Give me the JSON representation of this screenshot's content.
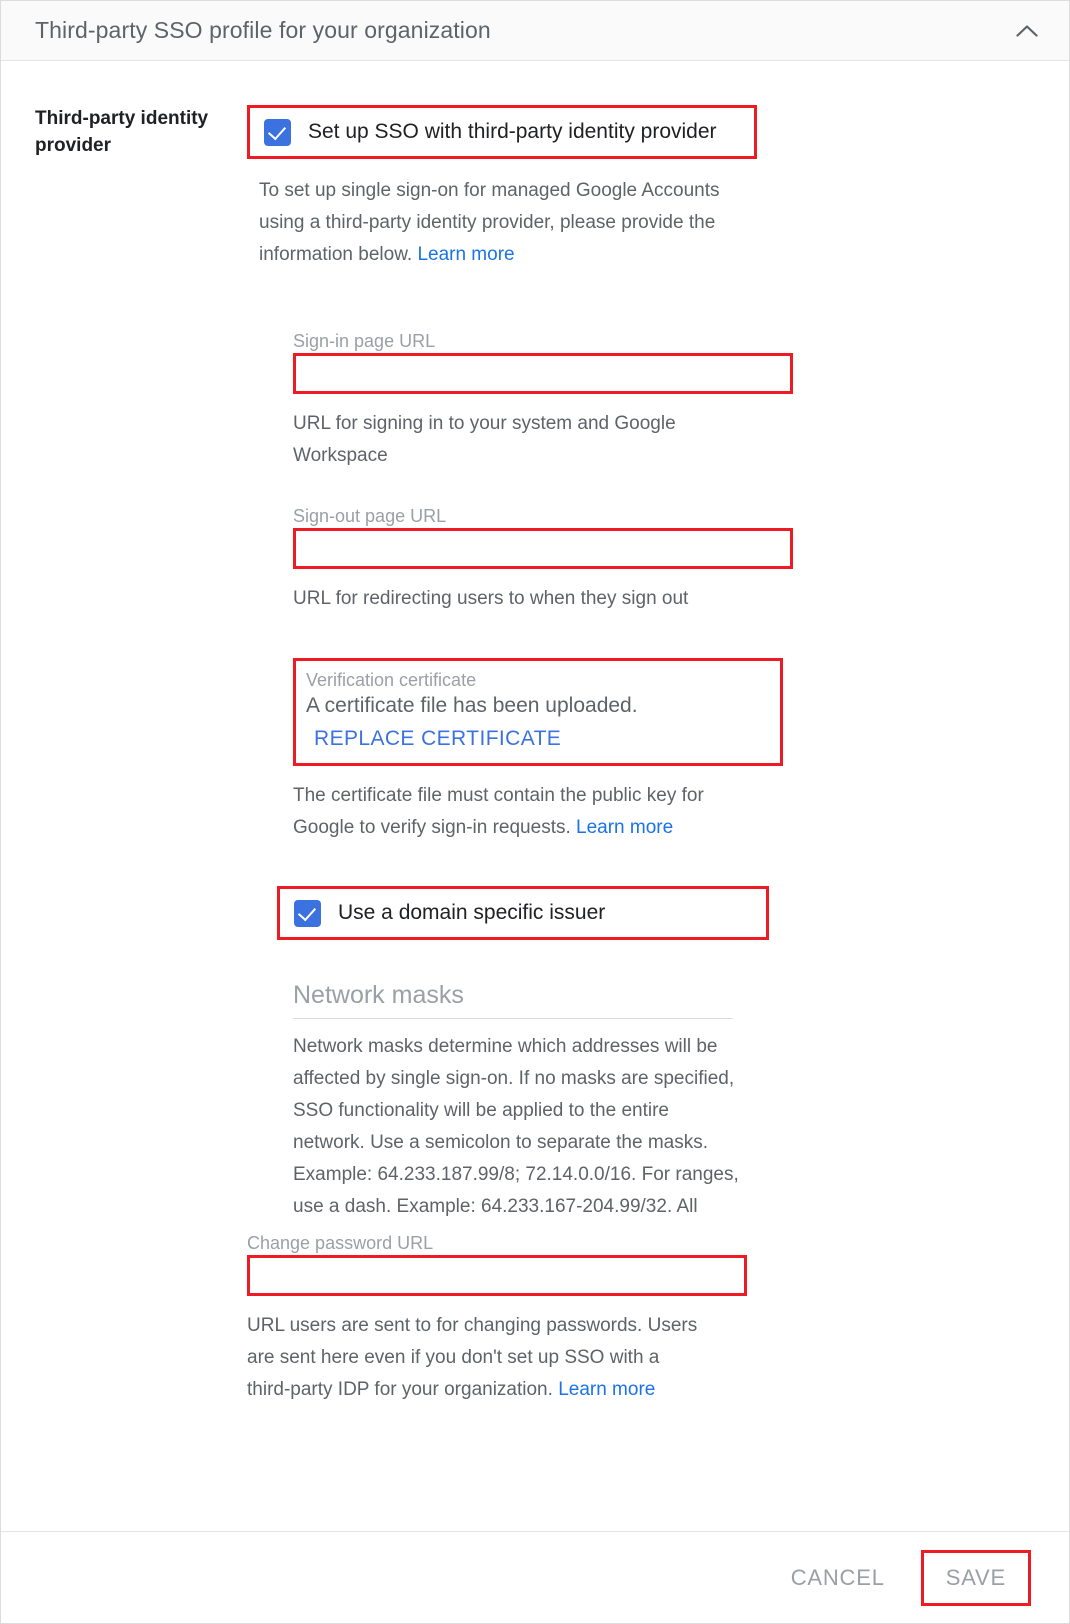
{
  "header": {
    "title": "Third-party SSO profile for your organization",
    "collapse_icon": "chevron-up-icon"
  },
  "section": {
    "left_label": "Third-party identity provider",
    "sso_checkbox": {
      "label": "Set up SSO with third-party identity provider",
      "checked": true
    },
    "intro": {
      "text": "To set up single sign-on for managed Google Accounts using a third-party identity provider, please provide the information below.",
      "link": "Learn more"
    }
  },
  "fields": {
    "signin": {
      "label": "Sign-in page URL",
      "value": "",
      "hint": "URL for signing in to your system and Google Workspace"
    },
    "signout": {
      "label": "Sign-out page URL",
      "value": "",
      "hint": "URL for redirecting users to when they sign out"
    },
    "certificate": {
      "caption": "Verification certificate",
      "status": "A certificate file has been uploaded.",
      "replace_button": "REPLACE CERTIFICATE",
      "hint_text": "The certificate file must contain the public key for Google to verify sign-in requests.",
      "hint_link": "Learn more"
    },
    "domain_issuer": {
      "label": "Use a domain specific issuer",
      "checked": true
    },
    "network_masks": {
      "title": "Network masks",
      "description": "Network masks determine which addresses will be affected by single sign-on. If no masks are specified, SSO functionality will be applied to the entire network. Use a semicolon to separate the masks. Example: 64.233.187.99/8; 72.14.0.0/16. For ranges, use a dash. Example: 64.233.167-204.99/32. All"
    },
    "change_password": {
      "label": "Change password URL",
      "value": "",
      "hint_text": "URL users are sent to for changing passwords. Users are sent here even if you don't set up SSO with a third-party IDP for your organization.",
      "hint_link": "Learn more"
    }
  },
  "footer": {
    "cancel_label": "CANCEL",
    "save_label": "SAVE"
  },
  "colors": {
    "highlight": "#ee1b24",
    "accent_blue": "#3c72e0",
    "link_blue": "#1a73e8",
    "muted_text": "#5f6368"
  }
}
